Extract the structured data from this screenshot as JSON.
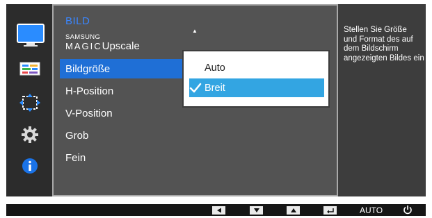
{
  "menu": {
    "title": "BILD",
    "items": [
      {
        "label_small": "SAMSUNG",
        "label_big": "MAGIC",
        "label_suffix": "Upscale"
      },
      {
        "label": "Bildgröße"
      },
      {
        "label": "H-Position"
      },
      {
        "label": "V-Position"
      },
      {
        "label": "Grob"
      },
      {
        "label": "Fein"
      }
    ],
    "selected_index": 1
  },
  "submenu": {
    "options": [
      "Auto",
      "Breit"
    ],
    "selected": "Breit"
  },
  "info": {
    "lines": [
      "Stellen Sie Größe",
      "und Format des auf",
      "dem Bildschirm",
      "angezeigten Bildes ein"
    ]
  },
  "sidebar": {
    "icons": [
      "monitor-icon",
      "picture-settings-icon",
      "resize-arrows-icon",
      "gear-icon",
      "info-icon"
    ]
  },
  "bottom_bar": {
    "buttons": [
      "left-arrow-icon",
      "down-arrow-icon",
      "up-arrow-icon",
      "enter-icon"
    ],
    "auto_label": "AUTO",
    "power_icon": "power-icon"
  },
  "colors": {
    "accent_blue": "#1f6fd6",
    "title_blue": "#3a86ff",
    "submenu_selected": "#33a5e2",
    "info_blue": "#1a73e8"
  }
}
